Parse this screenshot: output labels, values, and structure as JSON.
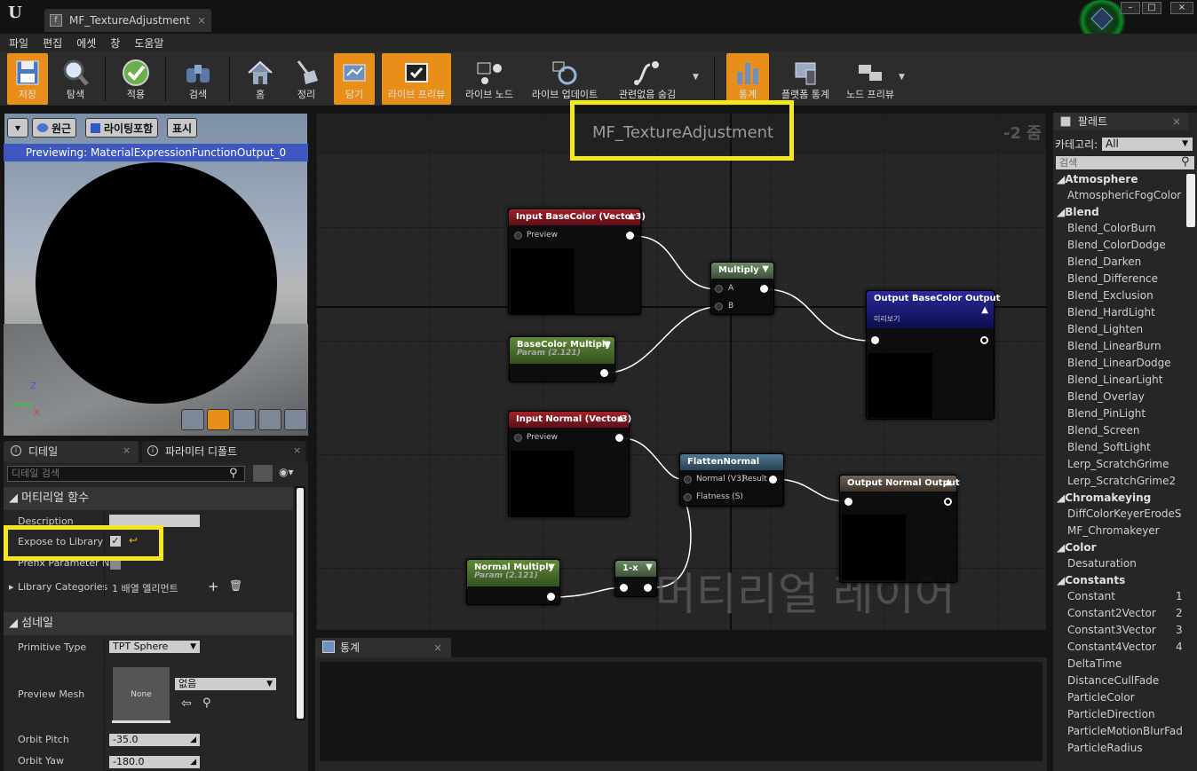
{
  "window": {
    "tab_title": "MF_TextureAdjustment",
    "tab_close": "×",
    "logo": "U",
    "min": "–",
    "max": "□",
    "close": "×"
  },
  "menu": [
    "파일",
    "편집",
    "에셋",
    "창",
    "도움말"
  ],
  "toolbar": {
    "save": "저장",
    "browse": "탐색",
    "apply": "적용",
    "search": "검색",
    "home": "홈",
    "clean": "정리",
    "hide_unrelated": "담기",
    "live_preview": "라이브 프리뷰",
    "live_nodes": "라이브 노드",
    "live_update": "라이브 업데이트",
    "hide_related": "관련없음 숨김",
    "stats": "통계",
    "platform_stats": "플랫폼 통계",
    "node_preview": "노드 프리뷰"
  },
  "viewport": {
    "btn_perspective": "원근",
    "btn_lit": "라이팅포함",
    "btn_show": "표시",
    "previewing": "Previewing: MaterialExpressionFunctionOutput_0",
    "axis_z": "Z",
    "axis_x": "X"
  },
  "left_tabs": {
    "details": "디테일",
    "params": "파라미터 디폴트"
  },
  "details": {
    "search_placeholder": "디테일 검색",
    "section_function": "머티리얼 함수",
    "description": "Description",
    "expose": "Expose to Library",
    "prefix": "Prefix Parameter N",
    "library_categories": "Library Categories",
    "library_value": "1 배열 엘리먼트",
    "section_thumbnail": "섬네일",
    "primitive_type": "Primitive Type",
    "primitive_value": "TPT Sphere",
    "preview_mesh": "Preview Mesh",
    "mesh_none": "None",
    "mesh_select": "없음",
    "orbit_pitch": "Orbit Pitch",
    "orbit_pitch_value": "-35.0",
    "orbit_yaw": "Orbit Yaw",
    "orbit_yaw_value": "-180.0"
  },
  "graph": {
    "title": "MF_TextureAdjustment",
    "zoom": "-2 줌",
    "watermark": "머티리얼 레이어",
    "nodes": {
      "input_basecolor": {
        "title": "Input BaseColor (Vector3)",
        "pin": "Preview"
      },
      "multiply": {
        "title": "Multiply",
        "pin_a": "A",
        "pin_b": "B"
      },
      "output_basecolor": {
        "title": "Output BaseColor Output",
        "sub": "미리보기"
      },
      "basecolor_multiply": {
        "title": "BaseColor Multiply",
        "sub": "Param (2.121)"
      },
      "input_normal": {
        "title": "Input Normal (Vector3)",
        "pin": "Preview"
      },
      "flatten": {
        "title": "FlattenNormal",
        "pin_normal": "Normal (V3)",
        "pin_result": "Result",
        "pin_flatness": "Flatness (S)"
      },
      "output_normal": {
        "title": "Output Normal Output"
      },
      "normal_multiply": {
        "title": "Normal Multiply",
        "sub": "Param (2.121)"
      },
      "one_minus": {
        "title": "1-x"
      }
    }
  },
  "stats": {
    "tab": "통계"
  },
  "palette": {
    "title": "팔레트",
    "category_label": "카테고리:",
    "category_value": "All",
    "search_placeholder": "검색",
    "groups": [
      {
        "name": "Atmosphere",
        "items": [
          "AtmosphericFogColor"
        ]
      },
      {
        "name": "Blend",
        "items": [
          "Blend_ColorBurn",
          "Blend_ColorDodge",
          "Blend_Darken",
          "Blend_Difference",
          "Blend_Exclusion",
          "Blend_HardLight",
          "Blend_Lighten",
          "Blend_LinearBurn",
          "Blend_LinearDodge",
          "Blend_LinearLight",
          "Blend_Overlay",
          "Blend_PinLight",
          "Blend_Screen",
          "Blend_SoftLight",
          "Lerp_ScratchGrime",
          "Lerp_ScratchGrime2"
        ]
      },
      {
        "name": "Chromakeying",
        "items": [
          "DiffColorKeyerErodeS",
          "MF_Chromakeyer"
        ]
      },
      {
        "name": "Color",
        "items": [
          "Desaturation"
        ]
      },
      {
        "name": "Constants",
        "items": [
          "Constant",
          "Constant2Vector",
          "Constant3Vector",
          "Constant4Vector",
          "DeltaTime",
          "DistanceCullFade",
          "ParticleColor",
          "ParticleDirection",
          "ParticleMotionBlurFad",
          "ParticleRadius"
        ]
      }
    ],
    "shortcuts": {
      "Constant": "1",
      "Constant2Vector": "2",
      "Constant3Vector": "3",
      "Constant4Vector": "4"
    }
  },
  "colors": {
    "accent": "#e88f1a",
    "highlight": "#f6e622",
    "preview_bar": "#3d56c0"
  }
}
